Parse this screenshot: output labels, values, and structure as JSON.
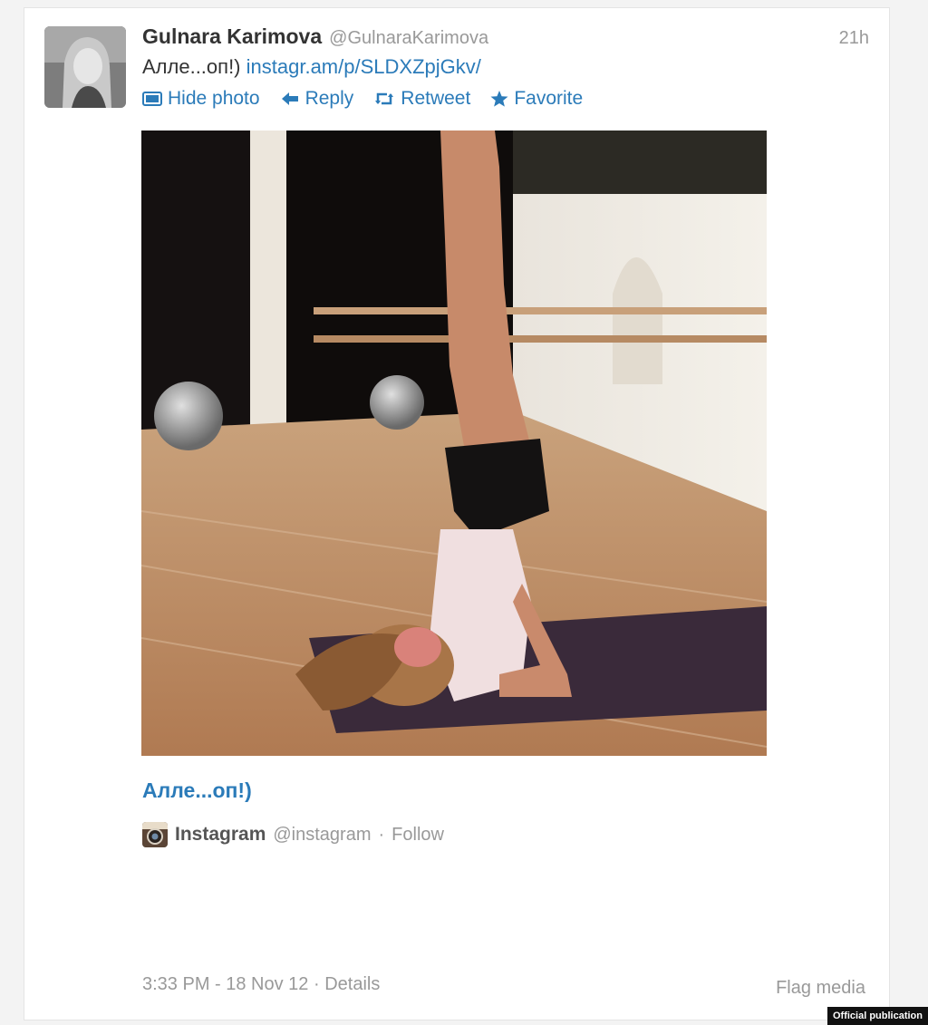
{
  "tweet": {
    "author_name": "Gulnara Karimova",
    "author_handle": "@GulnaraKarimova",
    "time_ago": "21h",
    "text_prefix": "Алле...оп!)",
    "link_text": "instagr.am/p/SLDXZpjGkv/",
    "actions": {
      "hide_photo": "Hide photo",
      "reply": "Reply",
      "retweet": "Retweet",
      "favorite": "Favorite"
    },
    "media": {
      "caption": "Алле...оп!)",
      "source_name": "Instagram",
      "source_handle": "@instagram",
      "separator": "·",
      "follow": "Follow"
    },
    "footer": {
      "timestamp": "3:33 PM - 18 Nov 12",
      "separator": "·",
      "details": "Details",
      "flag_media": "Flag media"
    }
  },
  "watermark": "Official publication",
  "colors": {
    "link": "#2b7bb9",
    "text": "#333333",
    "muted": "#999999"
  },
  "icons": [
    "photo-icon",
    "reply-arrow-icon",
    "retweet-icon",
    "star-icon",
    "instagram-icon"
  ]
}
